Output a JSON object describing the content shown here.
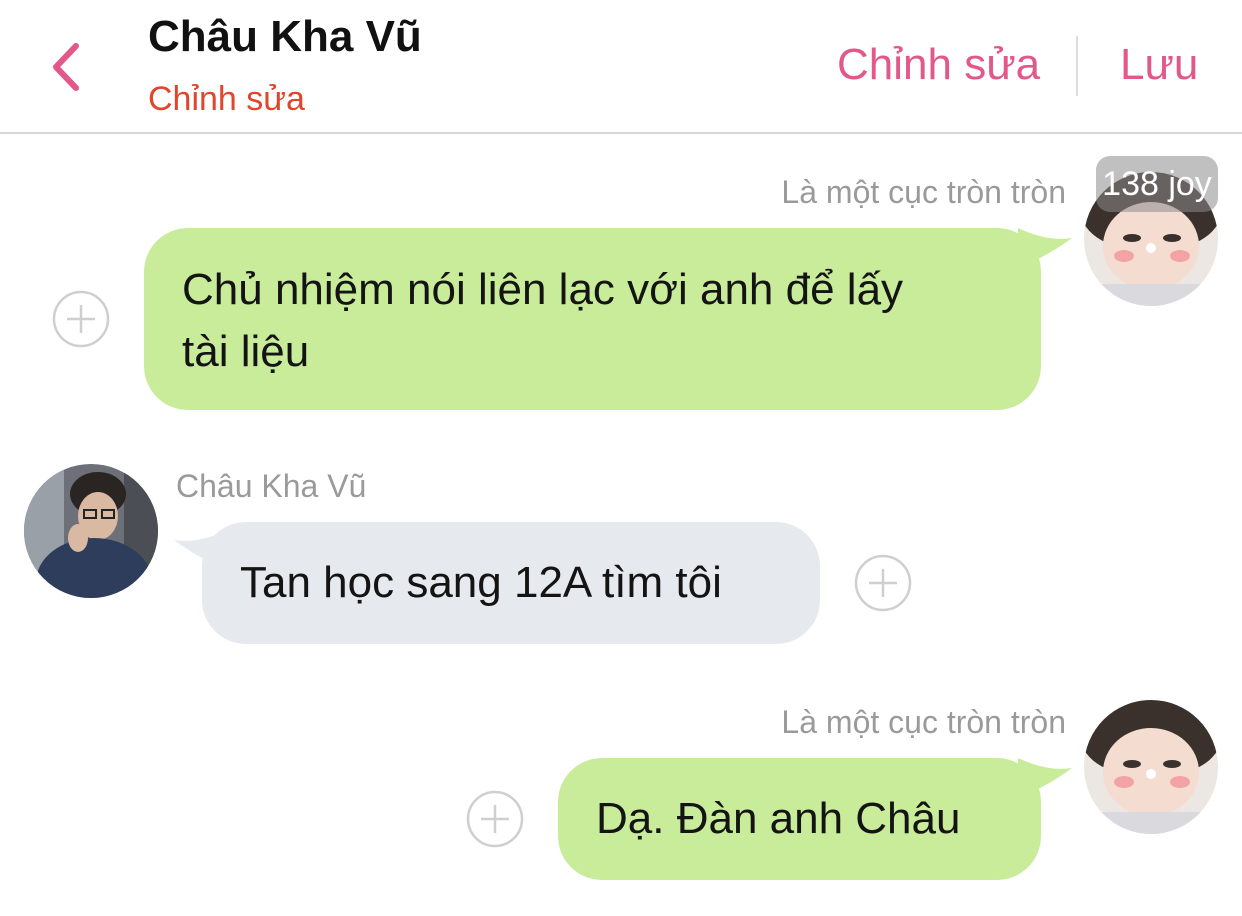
{
  "header": {
    "title": "Châu Kha Vũ",
    "subtitle": "Chỉnh sửa",
    "edit_label": "Chỉnh sửa",
    "save_label": "Lưu",
    "accent_color": "#e2588b",
    "subtitle_color": "#e0462c"
  },
  "messages": [
    {
      "direction": "outgoing",
      "sender": "Là một cục tròn tròn",
      "text_lines": [
        "Chủ nhiệm nói liên lạc với anh để lấy",
        "tài liệu"
      ],
      "avatar_badge": "138 joy",
      "bubble_color": "#c9ec9a"
    },
    {
      "direction": "incoming",
      "sender": "Châu Kha Vũ",
      "text_lines": [
        "Tan học sang 12A tìm tôi"
      ],
      "bubble_color": "#e6e9ed"
    },
    {
      "direction": "outgoing",
      "sender": "Là một cục tròn tròn",
      "text_lines": [
        "Dạ. Đàn anh Châu"
      ],
      "bubble_color": "#c9ec9a"
    }
  ]
}
